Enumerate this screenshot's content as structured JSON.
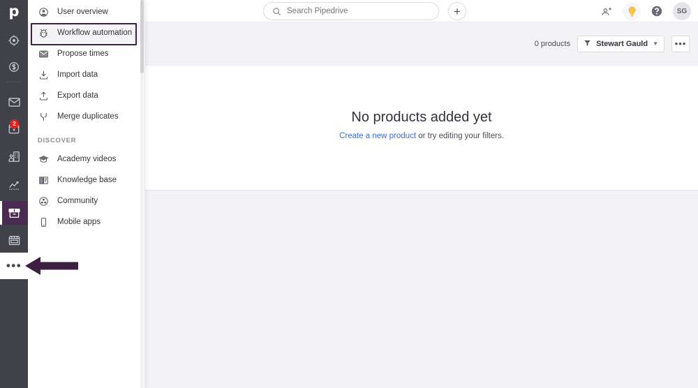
{
  "app": {
    "logo": "p",
    "brand_purple": "#4a2a50",
    "accent_blue": "#3b6be0",
    "badge_red": "#e4211c"
  },
  "rail": {
    "items": [
      {
        "name": "leads-icon",
        "label": "Leads",
        "badge": ""
      },
      {
        "name": "deals-icon",
        "label": "Deals",
        "badge": ""
      },
      {
        "name": "mail-icon",
        "label": "Mail",
        "badge": ""
      },
      {
        "name": "activities-calendar-icon",
        "label": "Activities",
        "badge": "2"
      },
      {
        "name": "contacts-icon",
        "label": "Contacts",
        "badge": ""
      },
      {
        "name": "insights-icon",
        "label": "Insights",
        "badge": ""
      },
      {
        "name": "products-icon",
        "label": "Products",
        "badge": ""
      },
      {
        "name": "marketplace-icon",
        "label": "Marketplace",
        "badge": ""
      }
    ],
    "more_label": "•••"
  },
  "flyout": {
    "items": [
      {
        "label": "User overview",
        "icon": "user-overview-icon"
      },
      {
        "label": "Workflow automation",
        "icon": "workflow-automation-icon"
      },
      {
        "label": "Propose times",
        "icon": "propose-times-icon"
      },
      {
        "label": "Import data",
        "icon": "import-data-icon"
      },
      {
        "label": "Export data",
        "icon": "export-data-icon"
      },
      {
        "label": "Merge duplicates",
        "icon": "merge-duplicates-icon"
      }
    ],
    "section_label": "DISCOVER",
    "discover_items": [
      {
        "label": "Academy videos",
        "icon": "academy-videos-icon"
      },
      {
        "label": "Knowledge base",
        "icon": "knowledge-base-icon"
      },
      {
        "label": "Community",
        "icon": "community-icon"
      },
      {
        "label": "Mobile apps",
        "icon": "mobile-apps-icon"
      }
    ]
  },
  "topbar": {
    "search": {
      "placeholder": "Search Pipedrive",
      "value": ""
    },
    "add_label": "+",
    "actions": [
      {
        "name": "invite-users-icon",
        "label": "Invite users"
      },
      {
        "name": "lightbulb-icon",
        "label": "What's new"
      },
      {
        "name": "help-icon",
        "label": "Help"
      }
    ],
    "avatar_initials": "SG"
  },
  "toolbar": {
    "count_label": "0 products",
    "filter_label": "Stewart Gauld",
    "more_label": "•••"
  },
  "empty_state": {
    "title": "No products added yet",
    "link_text": "Create a new product",
    "rest_text": " or try editing your filters."
  },
  "annotation": {
    "highlight_target": "Workflow automation",
    "arrow_target": "more-rail-button",
    "color": "#3c1f41"
  }
}
